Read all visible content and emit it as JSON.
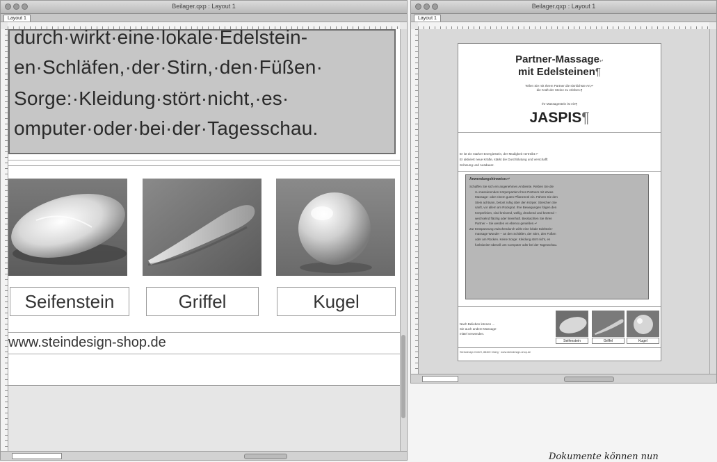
{
  "left_window": {
    "title": "Beilager.qxp : Layout 1",
    "tab": "Layout 1",
    "text_lines": [
      "durch·wirkt·eine·lokale·Edelstein-",
      "en·Schläfen,·der·Stirn,·den·Füßen·",
      "Sorge:·Kleidung·stört·nicht,·es·",
      "omputer·oder·bei·der·Tagesschau."
    ],
    "captions": [
      "Seifenstein",
      "Griffel",
      "Kugel"
    ],
    "url": "www.steindesign-shop.de"
  },
  "right_window": {
    "title": "Beilager.qxp : Layout 1",
    "tab": "Layout 1",
    "headline_1": "Partner-Massage",
    "headline_1_mark": "↵",
    "headline_2": "mit Edelsteinen",
    "headline_2_mark": "¶",
    "intro_1": "Teilen Sie mit Ihrem Partner die sinnlichste Art,↵",
    "intro_2": "die Kraft der Steine zu erleben.¶",
    "stone_intro": "Ihr Massagestein ist ein¶",
    "stone_name": "JASPIS",
    "stone_mark": "¶",
    "desc_1": "Er ist ein starker Energiestein, der Müdigkeit vertreibt.↵",
    "desc_2": "Er aktiviert neue Kräfte, stärkt die Durchblutung und verschafft",
    "desc_3": "Schwung und Ausdauer.",
    "usage_head": "Anwendungshinweise:↵",
    "usage_lines": [
      "Schaffen Sie sich ein angenehmes Ambiente. Reiben Sie die",
      "zu massierenden Körperpartien Ihres Partners mit etwas",
      "Massage- oder einem guten Pflanzenöl ein. Führen Sie den",
      "Stein achtsam, betont ruhig über den Körper. Streichen Sie",
      "sanft, vor allem am Rückgrat. Ihre Bewegungen folgen den",
      "Körperlinien, sind kreisend, wellig, drückend und knetend –",
      "wechselnd flächig oder linienhaft. Beobachten Sie Ihren",
      "Partner – Sie werden es ebenso genießen.↵",
      "Zur Entspannung zwischendurch wirkt eine lokale Edelstein-",
      "massage Wunder – an den Schläfen, der Stirn, den Füßen",
      "oder am Rücken. Keine Sorge: Kleidung stört nicht, es",
      "funktioniert überall: am Computer oder bei der Tagesschau."
    ],
    "note_1": "Nach Belieben können ...",
    "note_2": "Sie auch andere Massage-",
    "note_3": "mittel verwenden.",
    "captions": [
      "Seifenstein",
      "Griffel",
      "Kugel"
    ],
    "footer": "Steindesign GmbH, 88400 Ostrig · www.steindesign-shop.de"
  },
  "bottom_note": "Dokumente können nun"
}
